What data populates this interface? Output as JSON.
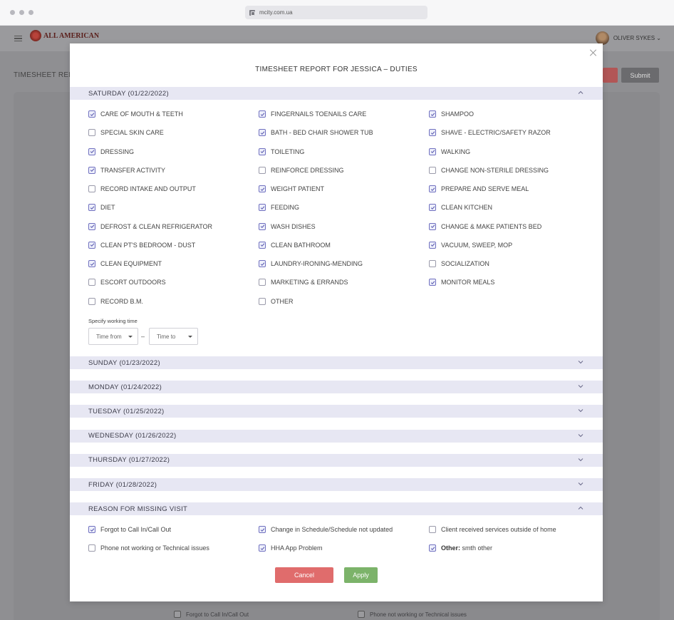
{
  "browser": {
    "url": "mcity.com.ua"
  },
  "header": {
    "logo_text": "ALL AMERICAN",
    "user_name": "OLIVER SYKES"
  },
  "page": {
    "title": "TIMESHEET REP",
    "submit_label": "Submit"
  },
  "background_footer": {
    "item1": "Forgot to Call In/Call Out",
    "item2": "Phone not working or Technical issues"
  },
  "modal": {
    "title": "TIMESHEET REPORT FOR JESSICA – DUTIES",
    "saturday": {
      "label": "SATURDAY (01/22/2022)",
      "duties": [
        {
          "label": "CARE OF MOUTH & TEETH",
          "checked": true
        },
        {
          "label": "FINGERNAILS TOENAILS CARE",
          "checked": true
        },
        {
          "label": "SHAMPOO",
          "checked": true
        },
        {
          "label": "SPECIAL SKIN CARE",
          "checked": false
        },
        {
          "label": "BATH - BED CHAIR SHOWER TUB",
          "checked": true
        },
        {
          "label": "SHAVE - ELECTRIC/SAFETY RAZOR",
          "checked": true
        },
        {
          "label": "DRESSING",
          "checked": true
        },
        {
          "label": "TOILETING",
          "checked": true
        },
        {
          "label": "WALKING",
          "checked": true
        },
        {
          "label": "TRANSFER ACTIVITY",
          "checked": true
        },
        {
          "label": "REINFORCE DRESSING",
          "checked": false
        },
        {
          "label": "CHANGE NON-STERILE DRESSING",
          "checked": false
        },
        {
          "label": "RECORD INTAKE AND OUTPUT",
          "checked": false
        },
        {
          "label": "WEIGHT PATIENT",
          "checked": true
        },
        {
          "label": "PREPARE AND SERVE MEAL",
          "checked": true
        },
        {
          "label": "DIET",
          "checked": true
        },
        {
          "label": "FEEDING",
          "checked": true
        },
        {
          "label": "CLEAN KITCHEN",
          "checked": true
        },
        {
          "label": "DEFROST & CLEAN REFRIGERATOR",
          "checked": true
        },
        {
          "label": "WASH DISHES",
          "checked": true
        },
        {
          "label": "CHANGE & MAKE PATIENTS BED",
          "checked": true
        },
        {
          "label": "CLEAN PT'S BEDROOM - DUST",
          "checked": true
        },
        {
          "label": "CLEAN BATHROOM",
          "checked": true
        },
        {
          "label": "VACUUM, SWEEP, MOP",
          "checked": true
        },
        {
          "label": "CLEAN EQUIPMENT",
          "checked": true
        },
        {
          "label": "LAUNDRY-IRONING-MENDING",
          "checked": true
        },
        {
          "label": "SOCIALIZATION",
          "checked": false
        },
        {
          "label": "ESCORT OUTDOORS",
          "checked": false
        },
        {
          "label": "MARKETING & ERRANDS",
          "checked": false
        },
        {
          "label": "MONITOR MEALS",
          "checked": true
        },
        {
          "label": "RECORD B.M.",
          "checked": false
        },
        {
          "label": "OTHER",
          "checked": false
        }
      ],
      "working_time_label": "Specify working time",
      "time_from_placeholder": "Time from",
      "time_to_placeholder": "Time to",
      "dash": "–"
    },
    "days": [
      {
        "label": "SUNDAY (01/23/2022)"
      },
      {
        "label": "MONDAY (01/24/2022)"
      },
      {
        "label": "TUESDAY (01/25/2022)"
      },
      {
        "label": "WEDNESDAY (01/26/2022)"
      },
      {
        "label": "THURSDAY (01/27/2022)"
      },
      {
        "label": "FRIDAY (01/28/2022)"
      }
    ],
    "reason": {
      "label": "REASON FOR MISSING VISIT",
      "options": [
        {
          "label": "Forgot to Call In/Call Out",
          "checked": true
        },
        {
          "label": "Change in Schedule/Schedule not updated",
          "checked": true
        },
        {
          "label": "Client received services outside of home",
          "checked": false
        },
        {
          "label": "Phone not working or Technical issues",
          "checked": false
        },
        {
          "label": "HHA App Problem",
          "checked": true
        },
        {
          "label": "smth other",
          "prefix": "Other:",
          "checked": true
        }
      ]
    },
    "cancel_label": "Cancel",
    "apply_label": "Apply"
  }
}
